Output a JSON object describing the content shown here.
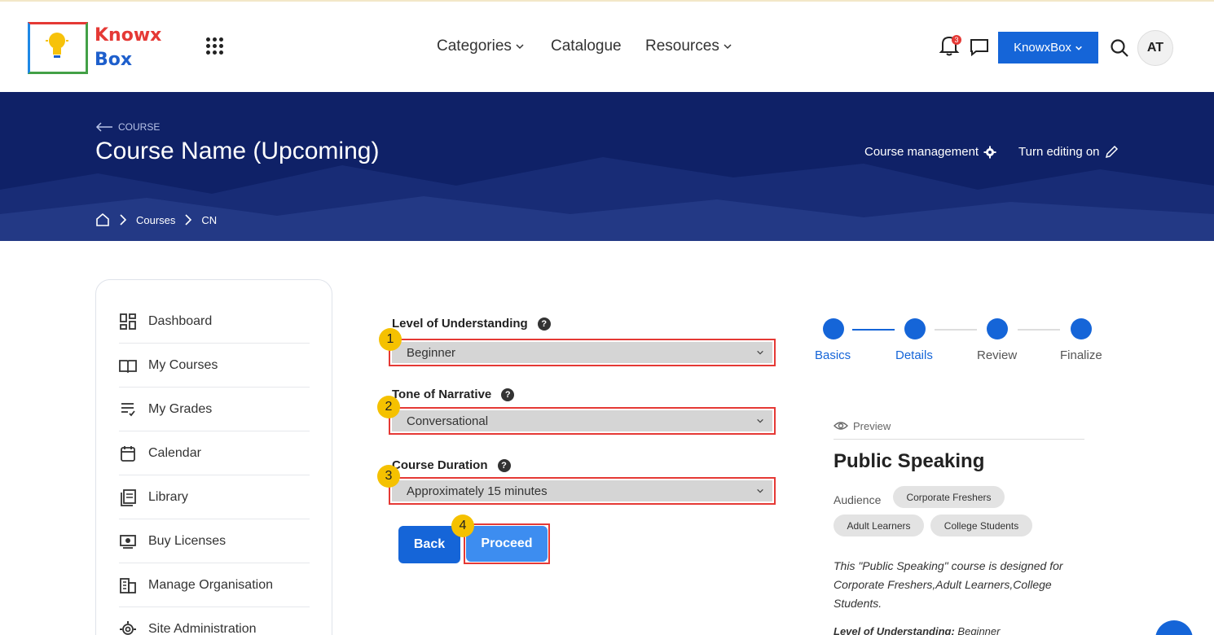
{
  "header": {
    "logo_line1": "Knowx",
    "logo_line2": "Box",
    "nav": {
      "categories": "Categories",
      "catalogue": "Catalogue",
      "resources": "Resources"
    },
    "notification_count": "3",
    "org_button": "KnowxBox",
    "avatar_initials": "AT"
  },
  "banner": {
    "back_label": "COURSE",
    "title": "Course Name (Upcoming)",
    "course_management": "Course management",
    "turn_editing": "Turn editing on",
    "breadcrumb": [
      "Courses",
      "CN"
    ]
  },
  "sidebar": {
    "items": [
      {
        "label": "Dashboard",
        "icon": "dashboard-icon"
      },
      {
        "label": "My Courses",
        "icon": "book-icon"
      },
      {
        "label": "My Grades",
        "icon": "grades-icon"
      },
      {
        "label": "Calendar",
        "icon": "calendar-icon"
      },
      {
        "label": "Library",
        "icon": "library-icon"
      },
      {
        "label": "Buy Licenses",
        "icon": "license-icon"
      },
      {
        "label": "Manage Organisation",
        "icon": "organisation-icon"
      },
      {
        "label": "Site Administration",
        "icon": "gear-icon"
      }
    ]
  },
  "form": {
    "level_label": "Level of Understanding",
    "level_value": "Beginner",
    "tone_label": "Tone of Narrative",
    "tone_value": "Conversational",
    "duration_label": "Course Duration",
    "duration_value": "Approximately 15 minutes",
    "back_button": "Back",
    "proceed_button": "Proceed",
    "annotations": [
      "1",
      "2",
      "3",
      "4"
    ]
  },
  "stepper": {
    "steps": [
      "Basics",
      "Details",
      "Review",
      "Finalize"
    ],
    "active_color": "#1565d8",
    "inactive_label_color": "#555555"
  },
  "preview": {
    "heading": "Preview",
    "title": "Public Speaking",
    "audience_label": "Audience",
    "chips": [
      "Corporate Freshers",
      "Adult Learners",
      "College Students"
    ],
    "description": "This \"Public Speaking\" course is designed for Corporate Freshers,Adult Learners,College Students.",
    "lou_label": "Level of Understanding:",
    "lou_value": "Beginner"
  }
}
